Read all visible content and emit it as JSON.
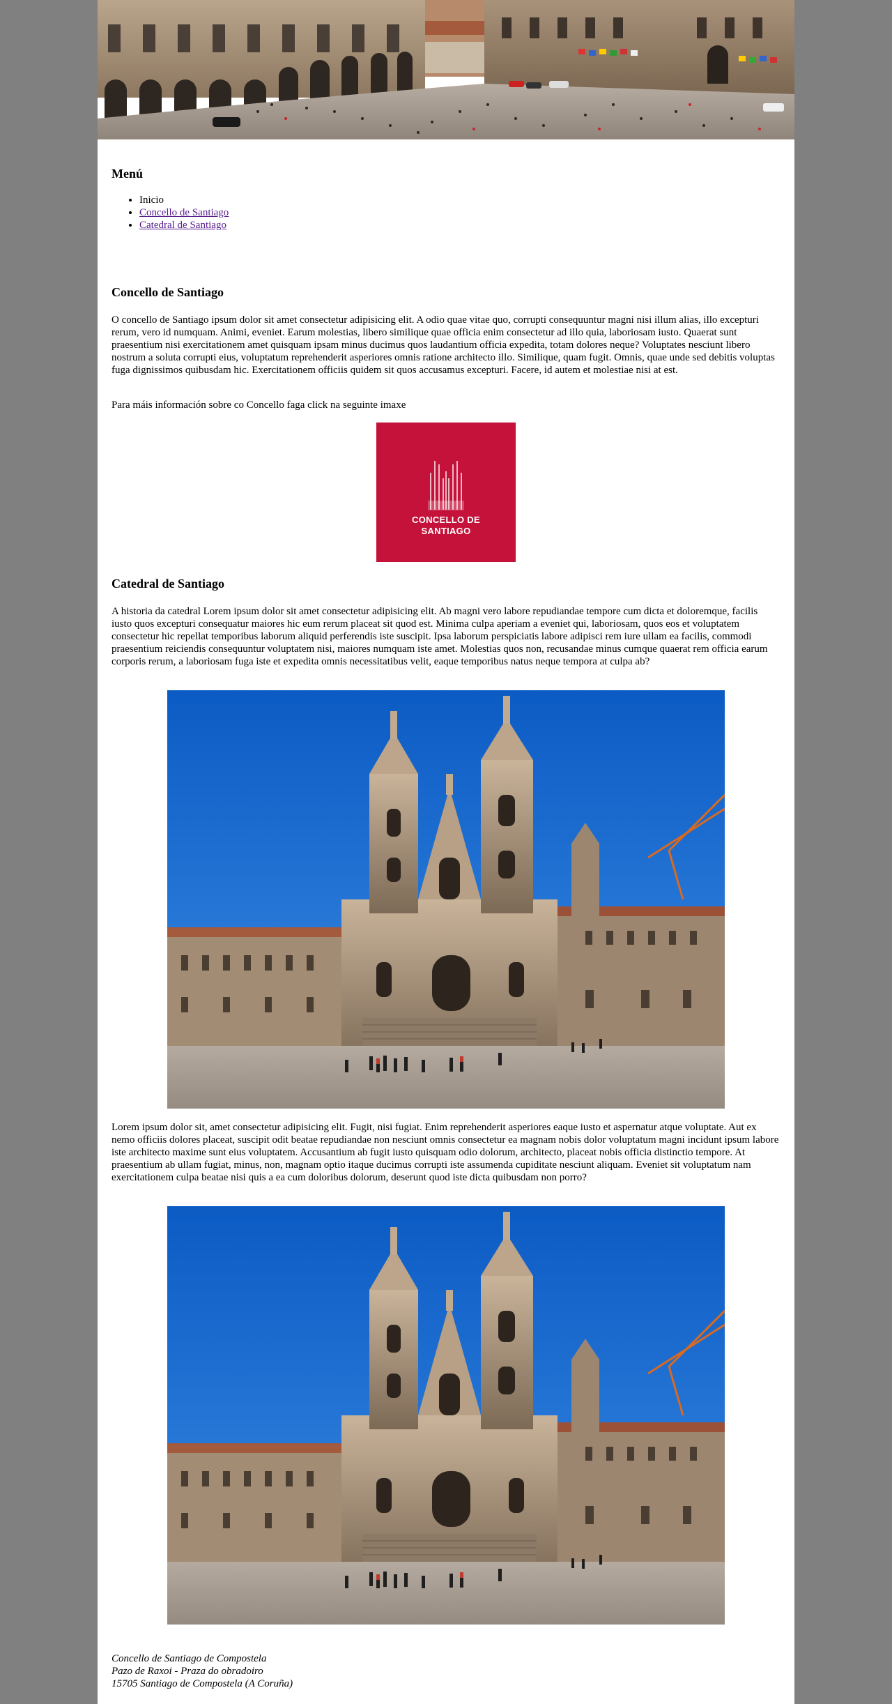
{
  "banner": {
    "alt_icon": "photo-icon"
  },
  "menu": {
    "title": "Menú",
    "items": [
      {
        "label": "Inicio",
        "is_link": false
      },
      {
        "label": "Concello de Santiago",
        "is_link": true
      },
      {
        "label": "Catedral de Santiago",
        "is_link": true
      }
    ]
  },
  "concello": {
    "title": "Concello de Santiago",
    "paragraph": "O concello de Santiago ipsum dolor sit amet consectetur adipisicing elit. A odio quae vitae quo, corrupti consequuntur magni nisi illum alias, illo excepturi rerum, vero id numquam. Animi, eveniet. Earum molestias, libero similique quae officia enim consectetur ad illo quia, laboriosam iusto. Quaerat sunt praesentium nisi exercitationem amet quisquam ipsam minus ducimus quos laudantium officia expedita, totam dolores neque? Voluptates nesciunt libero nostrum a soluta corrupti eius, voluptatum reprehenderit asperiores omnis ratione architecto illo. Similique, quam fugit. Omnis, quae unde sed debitis voluptas fuga dignissimos quibusdam hic. Exercitationem officiis quidem sit quos accusamus excepturi. Facere, id autem et molestiae nisi at est.",
    "more_info": "Para máis información sobre co Concello faga click na seguinte imaxe",
    "logo_line1": "CONCELLO DE",
    "logo_line2": "SANTIAGO",
    "logo_color": "#c4123a"
  },
  "catedral": {
    "title": "Catedral de Santiago",
    "paragraph1": "A historia da catedral Lorem ipsum dolor sit amet consectetur adipisicing elit. Ab magni vero labore repudiandae tempore cum dicta et doloremque, facilis iusto quos excepturi consequatur maiores hic eum rerum placeat sit quod est. Minima culpa aperiam a eveniet qui, laboriosam, quos eos et voluptatem consectetur hic repellat temporibus laborum aliquid perferendis iste suscipit. Ipsa laborum perspiciatis labore adipisci rem iure ullam ea facilis, commodi praesentium reiciendis consequuntur voluptatem nisi, maiores numquam iste amet. Molestias quos non, recusandae minus cumque quaerat rem officia earum corporis rerum, a laboriosam fuga iste et expedita omnis necessitatibus velit, eaque temporibus natus neque tempora at culpa ab?",
    "paragraph2": "Lorem ipsum dolor sit, amet consectetur adipisicing elit. Fugit, nisi fugiat. Enim reprehenderit asperiores eaque iusto et aspernatur atque voluptate. Aut ex nemo officiis dolores placeat, suscipit odit beatae repudiandae non nesciunt omnis consectetur ea magnam nobis dolor voluptatum magni incidunt ipsum labore iste architecto maxime sunt eius voluptatem. Accusantium ab fugit iusto quisquam odio dolorum, architecto, placeat nobis officia distinctio tempore. At praesentium ab ullam fugiat, minus, non, magnam optio itaque ducimus corrupti iste assumenda cupiditate nesciunt aliquam. Eveniet sit voluptatum nam exercitationem culpa beatae nisi quis a ea cum doloribus dolorum, deserunt quod iste dicta quibusdam non porro?"
  },
  "footer": {
    "line1": "Concello de Santiago de Compostela",
    "line2": "Pazo de Raxoi - Praza do obradoiro",
    "line3": "15705 Santiago de Compostela (A Coruña)"
  },
  "colors": {
    "page_background": "#808080",
    "content_background": "#ffffff",
    "visited_link": "#551a8b",
    "sky": "#1f6fd1"
  }
}
